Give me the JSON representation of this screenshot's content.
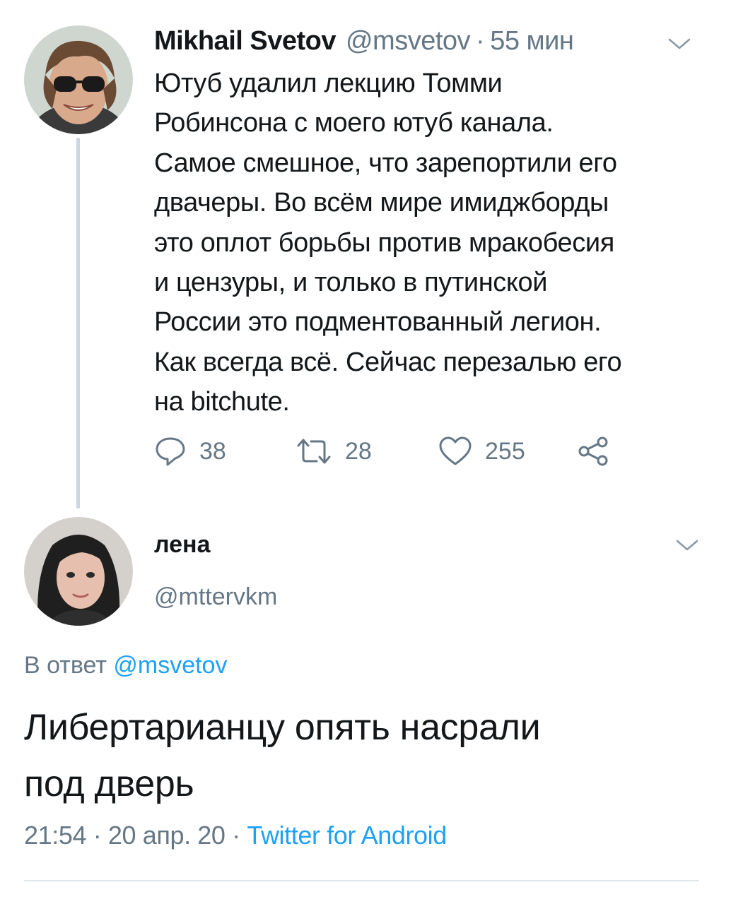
{
  "tweet": {
    "display_name": "Mikhail Svetov",
    "handle": "@msvetov",
    "separator": "·",
    "time_ago": "55 мин",
    "text": "Ютуб удалил лекцию Томми\nРобинсона с моего ютуб канала.\nСамое смешное, что зарепортили его\nдвачеры. Во всём мире имиджборды\nэто оплот борьбы против мракобесия\nи цензуры, и только в путинской\nРоссии это подментованный легион.\nКак всегда всё. Сейчас перезалью его\nна bitchute.",
    "replies": "38",
    "retweets": "28",
    "likes": "255",
    "avatar_icon": "user-avatar-icon"
  },
  "reply": {
    "display_name": "лена",
    "handle": "@mttervkm",
    "reply_to_label": "В ответ",
    "reply_to_handle": "@msvetov",
    "text": "Либертарианцу опять насрали\nпод дверь",
    "time": "21:54",
    "separator": "·",
    "date": "20 апр. 20",
    "source": "Twitter for Android",
    "avatar_icon": "user-avatar-icon"
  },
  "icons": {
    "reply": "reply-icon",
    "retweet": "retweet-icon",
    "like": "heart-icon",
    "share": "share-icon",
    "menu": "chevron-down-icon"
  },
  "colors": {
    "text": "#14171a",
    "secondary": "#657786",
    "link": "#1da1f2",
    "thread_line": "#cbd6de",
    "divider": "#e1e8ed"
  }
}
